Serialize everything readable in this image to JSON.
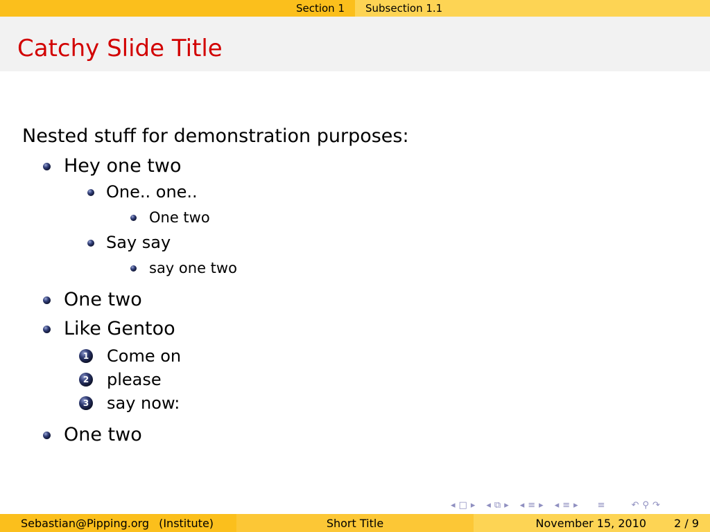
{
  "nav": {
    "section": "Section 1",
    "subsection": "Subsection 1.1"
  },
  "slide": {
    "title": "Catchy Slide Title",
    "intro": "Nested stuff for demonstration purposes:",
    "items": [
      {
        "text": "Hey one two",
        "children": [
          {
            "text": "One.. one..",
            "children": [
              {
                "text": "One two"
              }
            ]
          },
          {
            "text": "Say say",
            "children": [
              {
                "text": "say one two"
              }
            ]
          }
        ]
      },
      {
        "text": "One two"
      },
      {
        "text": "Like Gentoo",
        "enumerate": [
          {
            "number": "1",
            "text": "Come on"
          },
          {
            "number": "2",
            "text": "please"
          },
          {
            "number": "3",
            "text": "say now:"
          }
        ]
      },
      {
        "text": "One two"
      }
    ]
  },
  "footer": {
    "author": "Sebastian@Pipping.org",
    "institute": "(Institute)",
    "short_title": "Short Title",
    "date": "November 15, 2010",
    "page": "2 / 9"
  },
  "colors": {
    "title": "#d20000",
    "bar_dark": "#fbbf1c",
    "bar_light": "#fdd454",
    "title_bg": "#f2f2f2"
  },
  "icons": [
    "nav-left-icon",
    "frame-icon",
    "nav-right-icon",
    "subsection-icon",
    "section-icon",
    "align-icon",
    "search-icon",
    "undo-icon"
  ]
}
